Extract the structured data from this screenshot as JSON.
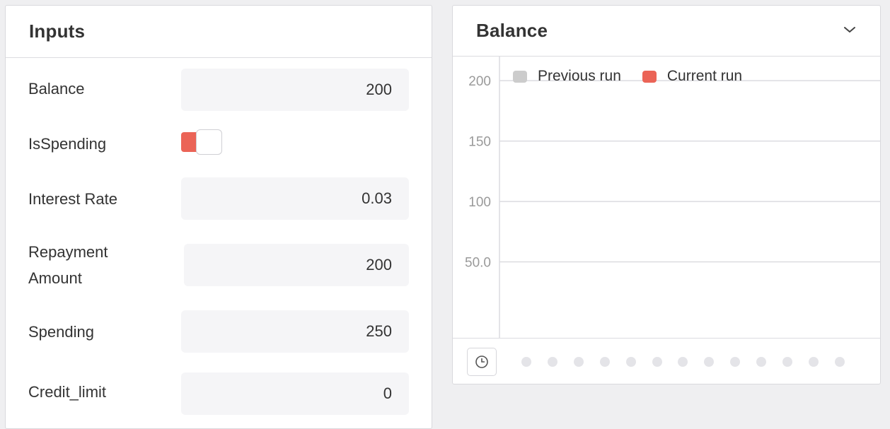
{
  "inputs_panel": {
    "title": "Inputs",
    "fields": [
      {
        "label": "Balance",
        "value": "200"
      },
      {
        "label": "IsSpending",
        "value": ""
      },
      {
        "label": "Interest Rate",
        "value": "0.03"
      },
      {
        "label": "Repayment Amount",
        "value": "200"
      },
      {
        "label": "Spending",
        "value": "250"
      },
      {
        "label": "Credit_limit",
        "value": "0"
      }
    ],
    "is_spending_on": true
  },
  "balance_panel": {
    "title": "Balance",
    "collapse_icon": "chevron-down-icon",
    "history_icon": "clock-icon",
    "timeline_dots": 13
  },
  "chart_data": {
    "type": "line",
    "title": "Balance",
    "series": [
      {
        "name": "Previous run",
        "values": [],
        "color": "#cccccc"
      },
      {
        "name": "Current run",
        "values": [],
        "color": "#eb6457"
      }
    ],
    "yticks": [
      "200",
      "150",
      "100",
      "50.0"
    ],
    "ytick_values": [
      200,
      150,
      100,
      50
    ],
    "ylim": [
      0,
      220
    ],
    "grid": true,
    "legend_position": "top-left"
  },
  "colors": {
    "accent": "#eb6457",
    "previous_run": "#cccccc",
    "grid": "#dcdce0"
  }
}
